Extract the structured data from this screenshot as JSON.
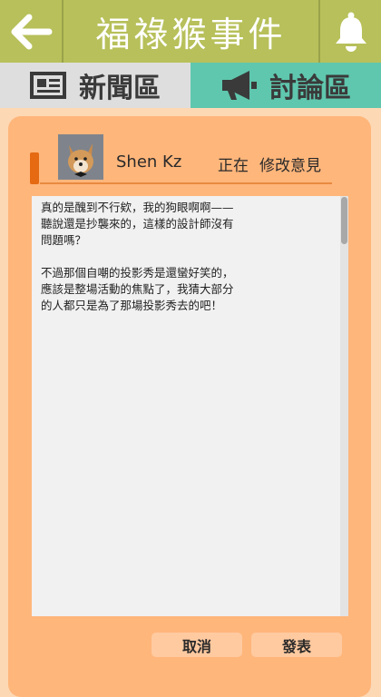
{
  "header": {
    "title": "福祿猴事件",
    "back_icon": "arrow-left-icon",
    "bell_icon": "bell-icon",
    "bg_color": "#b7c05a"
  },
  "tabs": [
    {
      "label": "新聞區",
      "icon": "newspaper-icon",
      "active": false
    },
    {
      "label": "討論區",
      "icon": "megaphone-icon",
      "active": true
    }
  ],
  "author": {
    "name": "Shen Kz",
    "status": "正在",
    "action": "修改意見",
    "avatar_icon": "shiba-avatar"
  },
  "editor": {
    "text": "真的是醜到不行欸，我的狗眼啊啊——\n聽說還是抄襲來的，這樣的設計師沒有\n問題嗎？\n\n不過那個自嘲的投影秀是還蠻好笑的，\n應該是整場活動的焦點了，我猜大部分\n的人都只是為了那場投影秀去的吧！"
  },
  "buttons": {
    "cancel": "取消",
    "post": "發表"
  },
  "colors": {
    "accent_orange": "#e56a12",
    "card_bg": "#ffb67b",
    "forum_tab": "#5fc7ae"
  }
}
